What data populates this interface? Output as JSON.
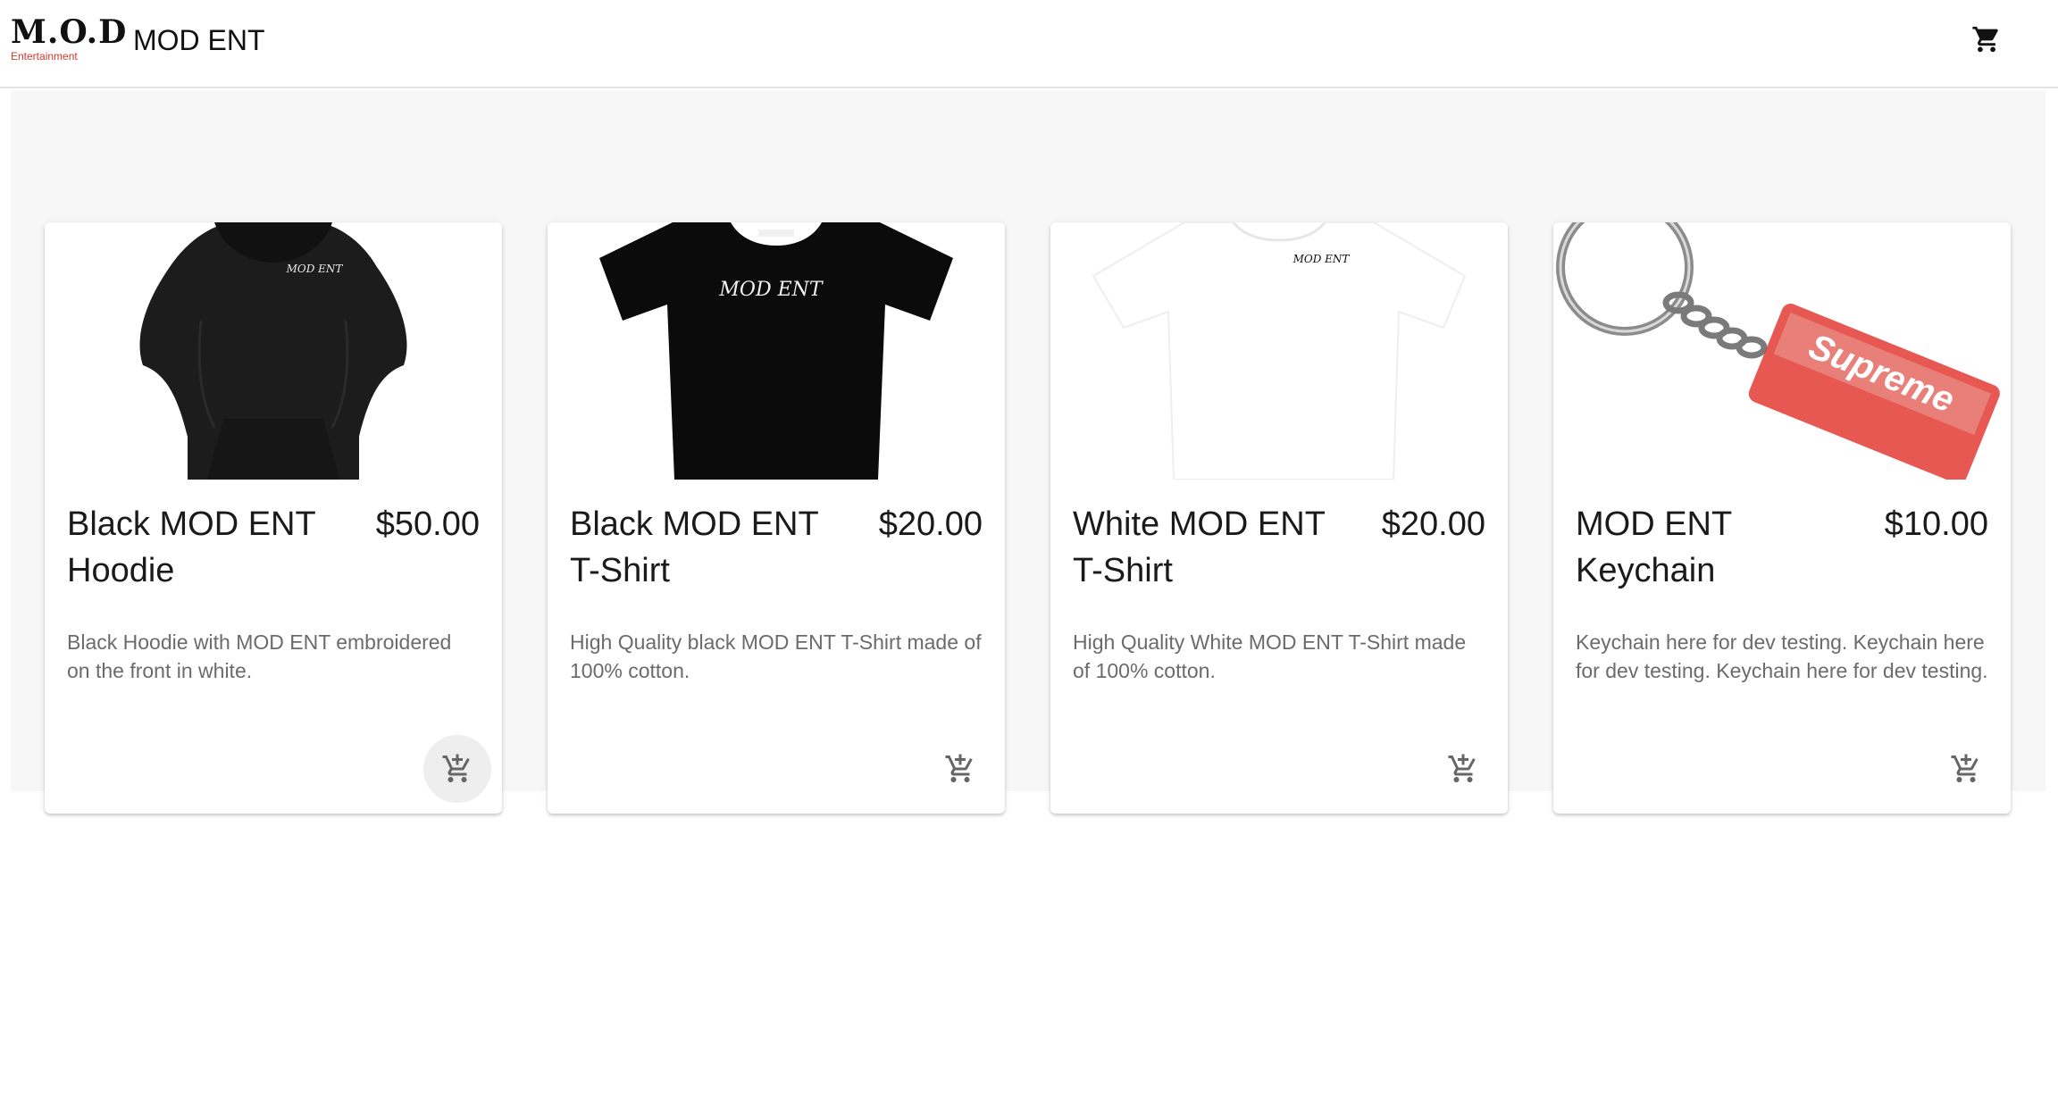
{
  "header": {
    "logo_text": "M.O.D",
    "logo_subtext": "Entertainment",
    "title": "MOD ENT",
    "cart_icon": "shopping-cart-icon"
  },
  "colors": {
    "accent": "#d03a2c",
    "background": "#f7f7f7",
    "card": "#ffffff",
    "text": "#1a1a1a",
    "muted_text": "#6b6b6b"
  },
  "products": [
    {
      "name": "Black MOD ENT Hoodie",
      "price": "$50.00",
      "description": "Black Hoodie with MOD ENT embroidered on the front in white.",
      "image_label": "MOD ENT",
      "add_icon": "add-shopping-cart-icon"
    },
    {
      "name": "Black MOD ENT T-Shirt",
      "price": "$20.00",
      "description": "High Quality black MOD ENT T-Shirt made of 100% cotton.",
      "image_label": "MOD ENT",
      "add_icon": "add-shopping-cart-icon"
    },
    {
      "name": "White MOD ENT T-Shirt",
      "price": "$20.00",
      "description": "High Quality White MOD ENT T-Shirt made of 100% cotton.",
      "image_label": "MOD ENT",
      "add_icon": "add-shopping-cart-icon"
    },
    {
      "name": "MOD ENT Keychain",
      "price": "$10.00",
      "description": "Keychain here for dev testing. Keychain here for dev testing. Keychain here for dev testing.",
      "image_label": "Supreme",
      "add_icon": "add-shopping-cart-icon"
    }
  ]
}
